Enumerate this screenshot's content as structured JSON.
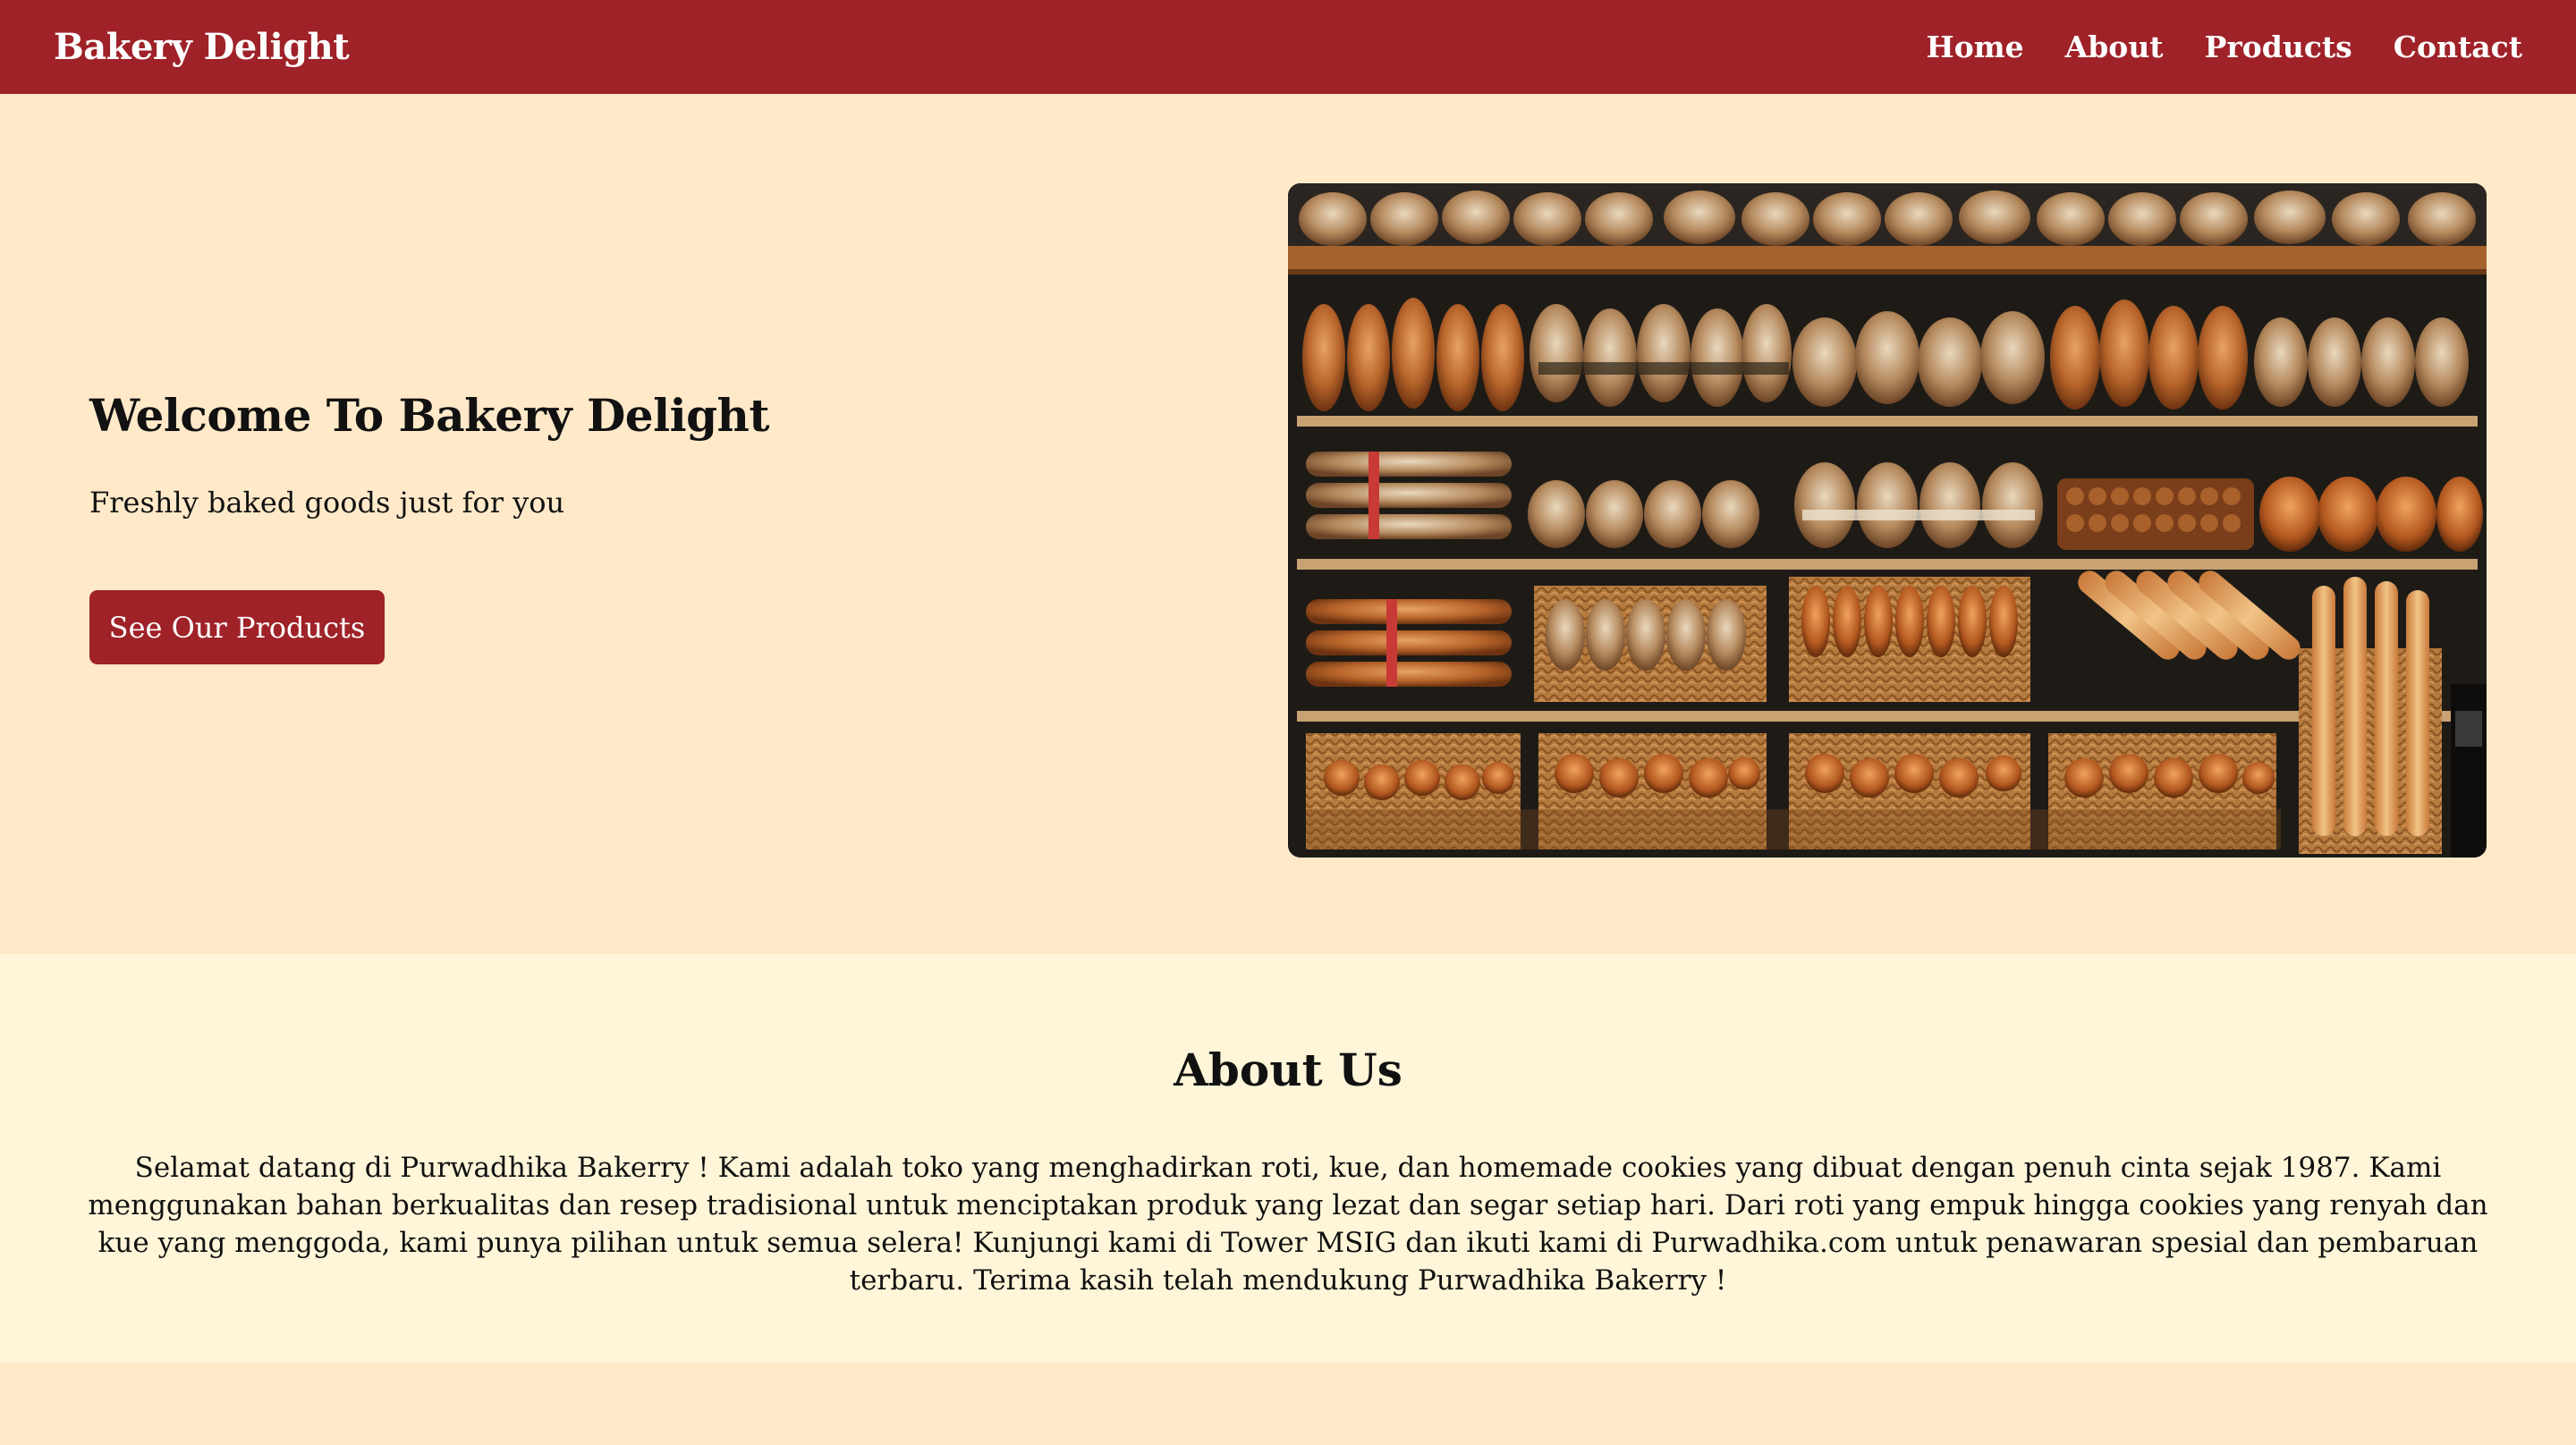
{
  "navbar": {
    "brand": "Bakery Delight",
    "links": [
      "Home",
      "About",
      "Products",
      "Contact"
    ]
  },
  "hero": {
    "title": "Welcome To Bakery Delight",
    "subtitle": "Freshly baked goods just for you",
    "button_label": "See Our Products",
    "image_alt": "bakery shelves with bread"
  },
  "about": {
    "title": "About Us",
    "body": "Selamat datang di Purwadhika Bakerry ! Kami adalah toko yang menghadirkan roti, kue, dan homemade cookies yang dibuat dengan penuh cinta sejak 1987. Kami menggunakan bahan berkualitas dan resep tradisional untuk menciptakan produk yang lezat dan segar setiap hari. Dari roti yang empuk hingga cookies yang renyah dan kue yang menggoda, kami punya pilihan untuk semua selera! Kunjungi kami di Tower MSIG dan ikuti kami di Purwadhika.com untuk penawaran spesial dan pembaruan terbaru. Terima kasih telah mendukung Purwadhika Bakerry !"
  },
  "colors": {
    "brand_red": "#9F2229",
    "hero_bg": "#FFE9C9",
    "about_bg": "#FFF6D9",
    "text": "#111111"
  }
}
